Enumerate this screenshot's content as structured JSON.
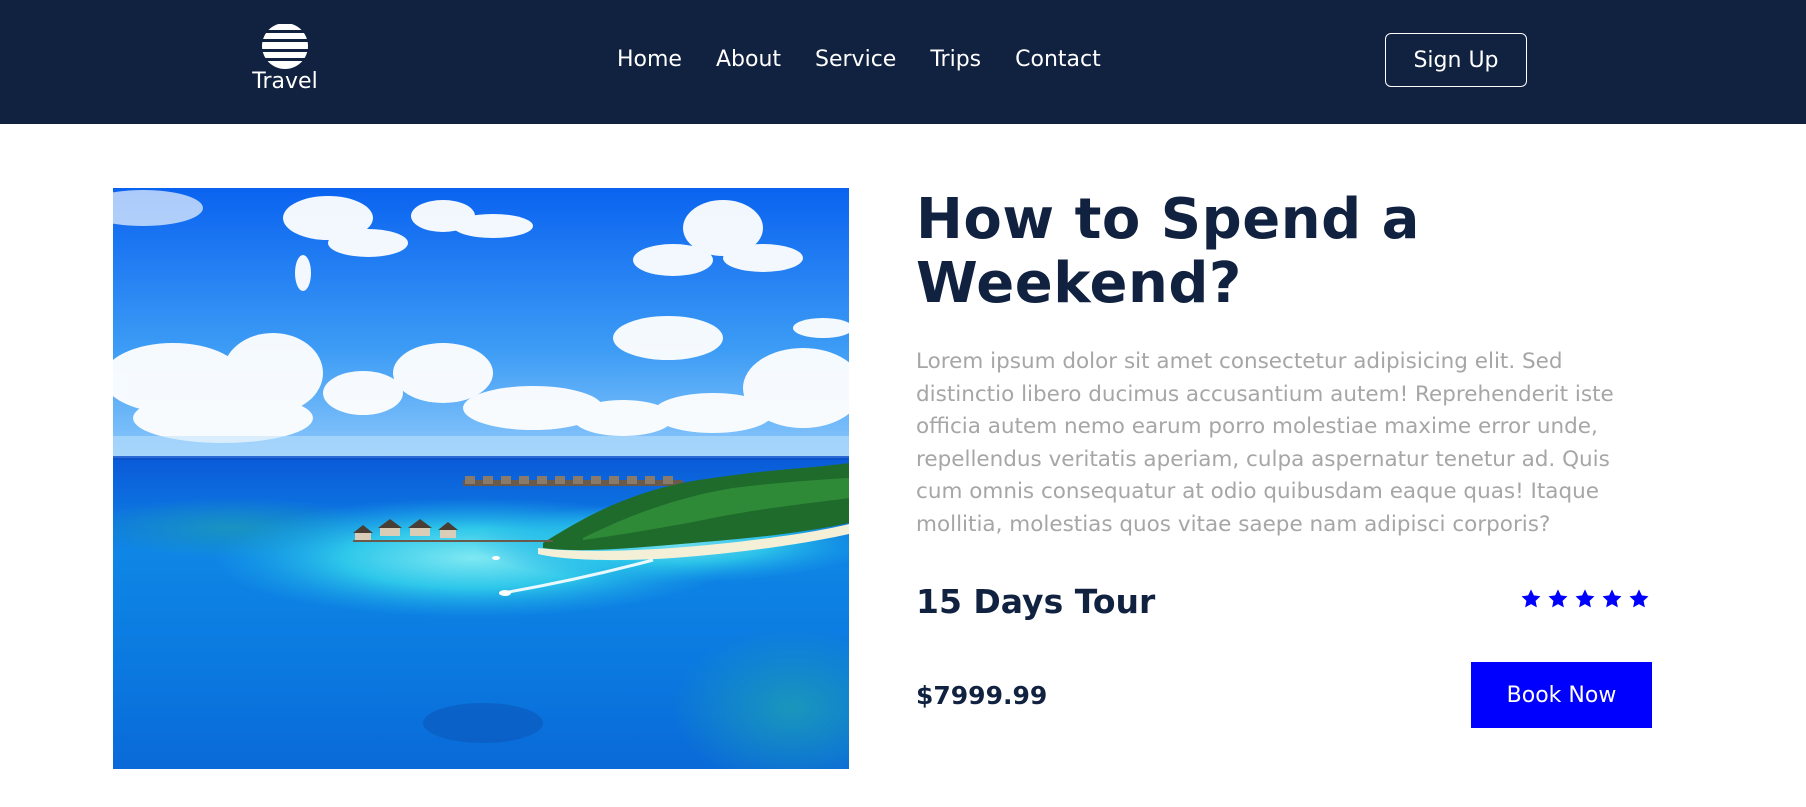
{
  "header": {
    "logo_text": "Travel",
    "logo_icon": "globe-icon",
    "nav": [
      {
        "label": "Home"
      },
      {
        "label": "About"
      },
      {
        "label": "Service"
      },
      {
        "label": "Trips"
      },
      {
        "label": "Contact"
      }
    ],
    "signup_label": "Sign Up"
  },
  "main": {
    "image_subject": "tropical island resort",
    "title": "How to Spend a Weekend?",
    "description": "Lorem ipsum dolor sit amet consectetur adipisicing elit. Sed distinctio libero ducimus accusantium autem! Reprehenderit iste officia autem nemo earum porro molestiae maxime error unde, repellendus veritatis aperiam, culpa aspernatur tenetur ad. Quis cum omnis consequatur at odio quibusdam eaque quas! Itaque mollitia, molestias quos vitae saepe nam adipisci corporis?",
    "tour_label": "15 Days Tour",
    "rating": 5,
    "rating_max": 5,
    "price": "$7999.99",
    "book_label": "Book Now"
  },
  "colors": {
    "header_bg": "#112240",
    "heading": "#112240",
    "body_text": "#a6a6a6",
    "accent": "#0000ff",
    "star": "#0000ff"
  }
}
